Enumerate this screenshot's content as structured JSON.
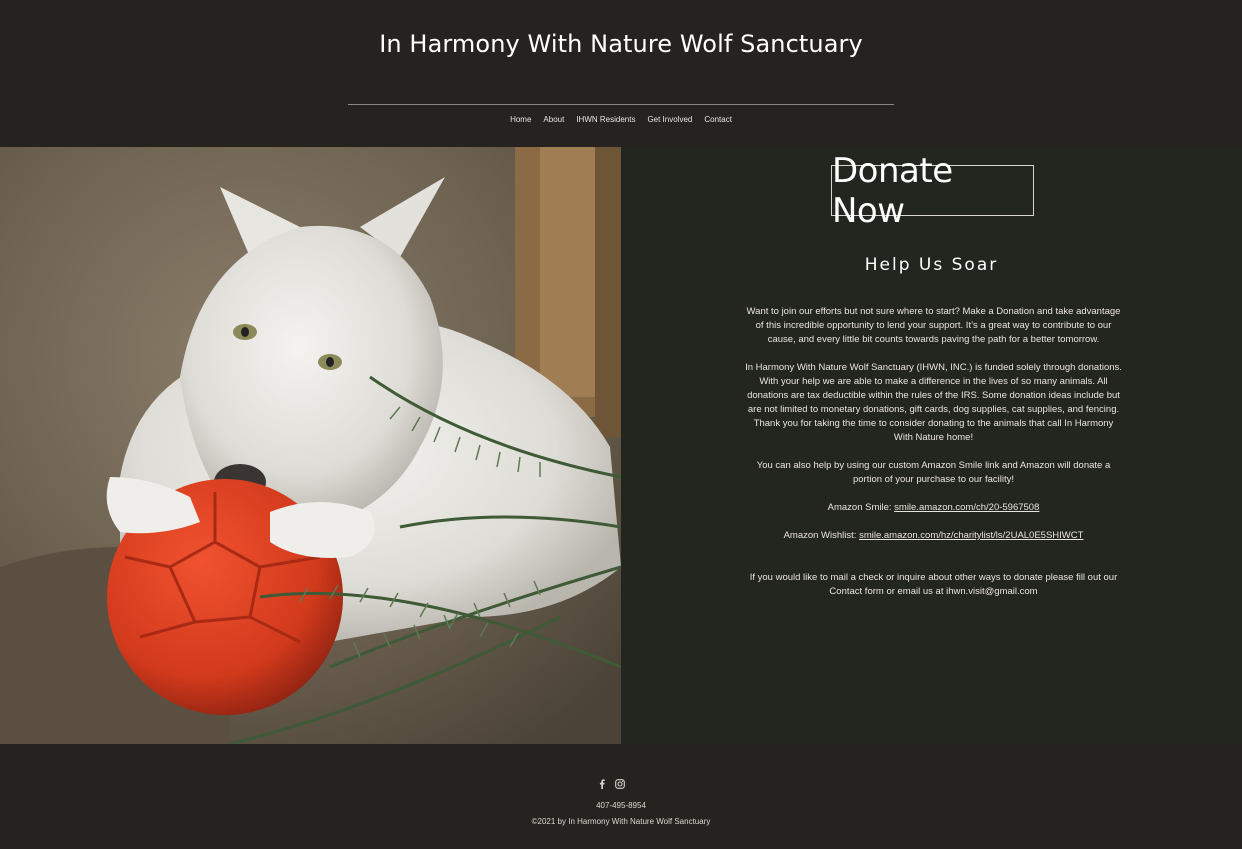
{
  "header": {
    "site_title": "In Harmony With Nature Wolf Sanctuary",
    "nav": [
      "Home",
      "About",
      "IHWN Residents",
      "Get Involved",
      "Contact"
    ]
  },
  "hero": {
    "image_alt": "White wolf with an orange ball"
  },
  "donate": {
    "button_label": "Donate Now",
    "heading": "Help Us Soar",
    "para1": "Want to join our efforts but not sure where to start? Make a Donation and take advantage of this incredible opportunity to lend your support. It’s a great way to contribute to our cause, and every little bit counts towards paving the path for a better tomorrow.",
    "para2": "In Harmony With Nature Wolf Sanctuary (IHWN, INC.) is funded solely through donations.  With your help we are able to make a difference in the lives of so many animals.  All donations are tax deductible within the rules of the IRS.  Some donation ideas include but are not limited to monetary donations, gift cards, dog supplies, cat supplies, and fencing.  Thank you for taking the time to consider donating to the animals that call In Harmony With Nature home!",
    "para3": "You can also help by using our custom Amazon Smile link and Amazon will donate a portion of your purchase to our facility!",
    "smile_label": "Amazon Smile: ",
    "smile_link": "smile.amazon.com/ch/20-5967508",
    "wishlist_label": "Amazon Wishlist: ",
    "wishlist_link": "smile.amazon.com/hz/charitylist/ls/2UAL0E5SHIWCT",
    "para4": "If you would like to mail a check or inquire about other ways to donate please fill out our Contact form or email us at ihwn.visit@gmail.com"
  },
  "footer": {
    "icons": [
      "facebook-icon",
      "instagram-icon"
    ],
    "phone": "407-495-8954",
    "copyright": "©2021 by In Harmony With Nature Wolf Sanctuary"
  }
}
